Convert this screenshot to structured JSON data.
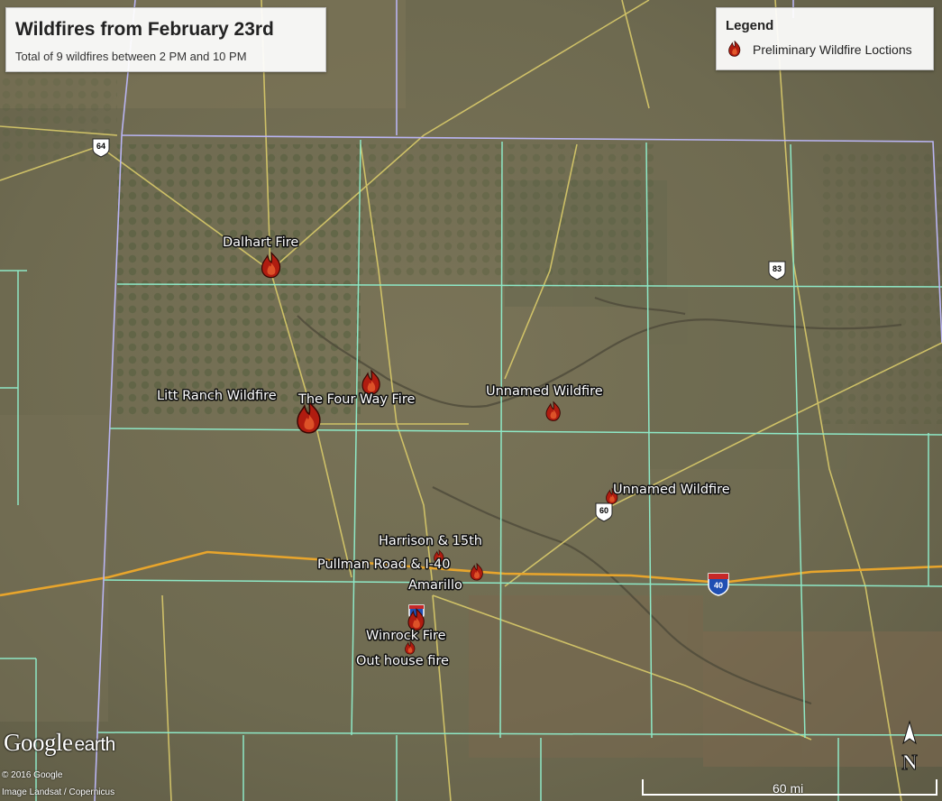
{
  "title": {
    "heading": "Wildfires from February 23rd",
    "subtitle": "Total of 9 wildfires between 2 PM and 10 PM"
  },
  "legend": {
    "heading": "Legend",
    "item_label": "Preliminary Wildfire Loctions",
    "icon": "flame-icon"
  },
  "fire_labels": [
    "Dalhart Fire",
    "Litt Ranch Wildfire",
    "The Four Way Fire",
    "Unnamed Wildfire",
    "Unnamed Wildfire",
    "Harrison & 15th",
    "Pullman Road & I-40",
    "Winrock Fire",
    "Out house fire"
  ],
  "city_label": "Amarillo",
  "highway_shields": [
    "64",
    "83",
    "60",
    "40"
  ],
  "attribution": {
    "logo_google": "Google",
    "logo_earth": "earth",
    "copyright": "© 2016 Google",
    "imagery": "Image Landsat / Copernicus"
  },
  "scale_bar": "60 mi",
  "compass": "N",
  "colors": {
    "county_lines": "#8ee8c6",
    "state_line": "#b9b4f2",
    "highways": "#d9ca6a",
    "interstate": "#e8a52c",
    "fire_icon": "#b01c10"
  }
}
